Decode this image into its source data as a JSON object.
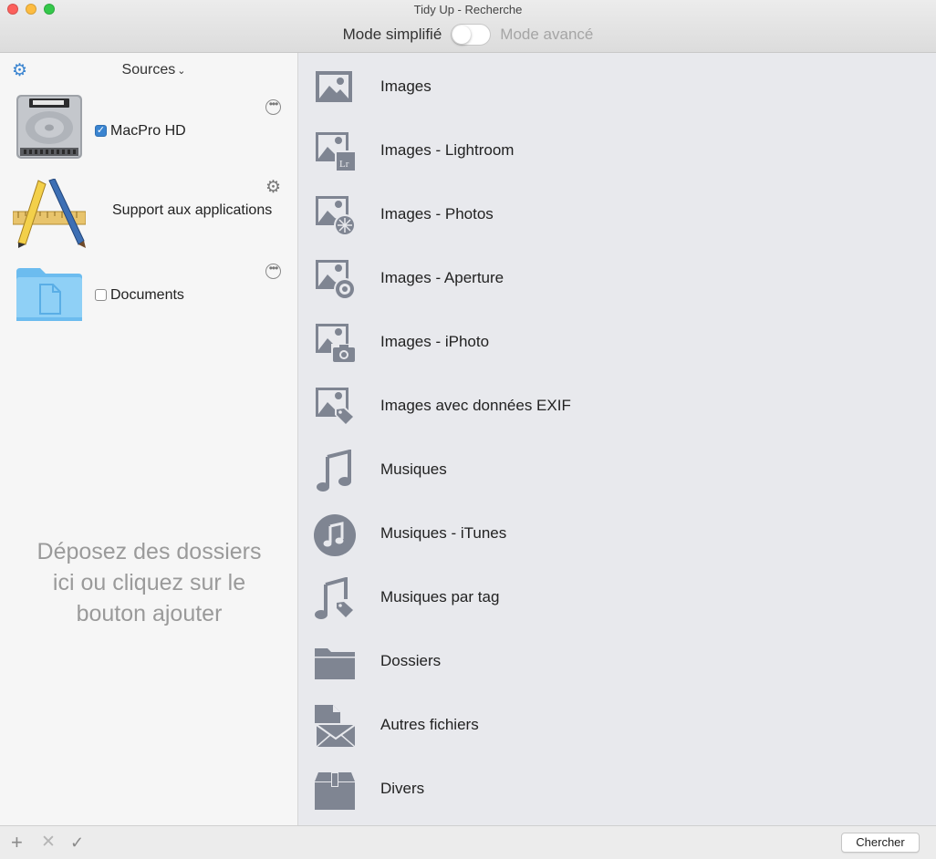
{
  "window": {
    "title": "Tidy Up - Recherche"
  },
  "mode": {
    "simple_label": "Mode simplifié",
    "advanced_label": "Mode avancé"
  },
  "sidebar": {
    "header_label": "Sources",
    "sources": [
      {
        "label": "MacPro HD",
        "checked": true,
        "icon": "hard-drive-icon"
      },
      {
        "label": "Support aux applications",
        "icon": "applications-icon"
      },
      {
        "label": "Documents",
        "checked": false,
        "icon": "folder-documents-icon"
      }
    ],
    "drop_hint": "Déposez des dossiers ici ou cliquez sur le bouton ajouter"
  },
  "categories": [
    {
      "label": "Images",
      "icon": "image-icon"
    },
    {
      "label": "Images - Lightroom",
      "icon": "image-lightroom-icon"
    },
    {
      "label": "Images - Photos",
      "icon": "image-photos-icon"
    },
    {
      "label": "Images - Aperture",
      "icon": "image-aperture-icon"
    },
    {
      "label": "Images - iPhoto",
      "icon": "image-iphoto-icon"
    },
    {
      "label": "Images avec données EXIF",
      "icon": "image-exif-icon"
    },
    {
      "label": "Musiques",
      "icon": "music-note-icon"
    },
    {
      "label": "Musiques - iTunes",
      "icon": "itunes-icon"
    },
    {
      "label": "Musiques par tag",
      "icon": "music-tag-icon"
    },
    {
      "label": "Dossiers",
      "icon": "folder-icon"
    },
    {
      "label": "Autres fichiers",
      "icon": "other-files-icon"
    },
    {
      "label": "Divers",
      "icon": "box-icon"
    }
  ],
  "bottom": {
    "search_label": "Chercher"
  },
  "colors": {
    "accent": "#3a84d0",
    "icon_gray": "#7f8592",
    "list_bg": "#e8e9ed"
  }
}
